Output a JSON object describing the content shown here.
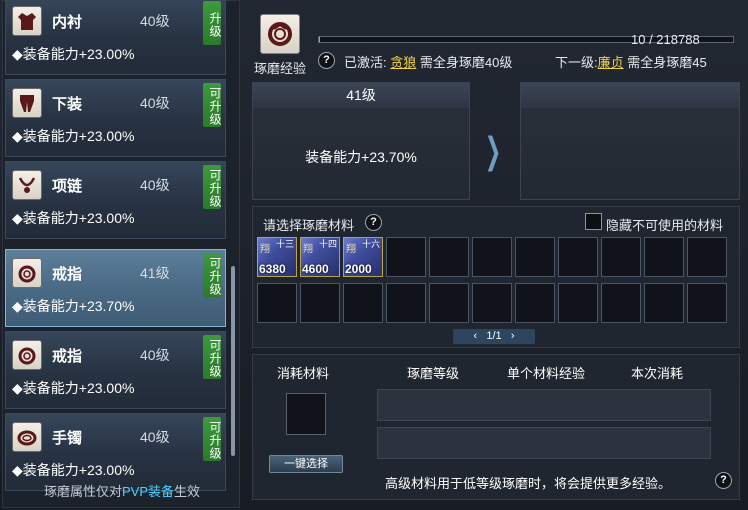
{
  "items": [
    {
      "name": "内衬",
      "level": "40级",
      "attr": "◆装备能力+23.00%",
      "tag": "升级",
      "icon": "shirt-icon",
      "selected": false
    },
    {
      "name": "下装",
      "level": "40级",
      "attr": "◆装备能力+23.00%",
      "tag": "可升级",
      "icon": "pants-icon",
      "selected": false
    },
    {
      "name": "项链",
      "level": "40级",
      "attr": "◆装备能力+23.00%",
      "tag": "可升级",
      "icon": "necklace-icon",
      "selected": false
    },
    {
      "name": "戒指",
      "level": "41级",
      "attr": "◆装备能力+23.70%",
      "tag": "可升级",
      "icon": "ring-icon",
      "selected": true
    },
    {
      "name": "戒指",
      "level": "40级",
      "attr": "◆装备能力+23.00%",
      "tag": "可升级",
      "icon": "ring-icon",
      "selected": false
    },
    {
      "name": "手镯",
      "level": "40级",
      "attr": "◆装备能力+23.00%",
      "tag": "可升级",
      "icon": "bracelet-icon",
      "selected": false
    }
  ],
  "left_footer": {
    "prefix": "琢磨属性仅对",
    "pvp": "PVP装备",
    "suffix": "生效"
  },
  "exp": {
    "label": "琢磨经验",
    "progress_text": "10 / 218788",
    "progress_fraction": 5e-05,
    "activated_prefix": "已激活:",
    "activated_link": "贪狼",
    "activated_req": "需全身琢磨40级",
    "next_prefix": "下一级:",
    "next_link": "廉贞",
    "next_req": "需全身琢磨45"
  },
  "current": {
    "level": "41级",
    "value": "装备能力+23.70%"
  },
  "next": {
    "level": "",
    "value": ""
  },
  "materials": {
    "title": "请选择琢磨材料",
    "hide_label": "隐藏不可使用的材料",
    "slots": [
      {
        "count": "6380",
        "grade": "十三",
        "name": "翔"
      },
      {
        "count": "4600",
        "grade": "十四",
        "name": "翔"
      },
      {
        "count": "2000",
        "grade": "十六",
        "name": "翔"
      }
    ],
    "page": "1/1"
  },
  "consume": {
    "headers": [
      "消耗材料",
      "琢磨等级",
      "单个材料经验",
      "本次消耗"
    ],
    "auto_select": "一键选择",
    "note": "高级材料用于低等级琢磨时，将会提供更多经验。"
  },
  "colors": {
    "accent": "#4fd0ff",
    "link": "#f1d34a",
    "tag_green": "#3d9a3d",
    "progress": "#6ab3e6"
  }
}
